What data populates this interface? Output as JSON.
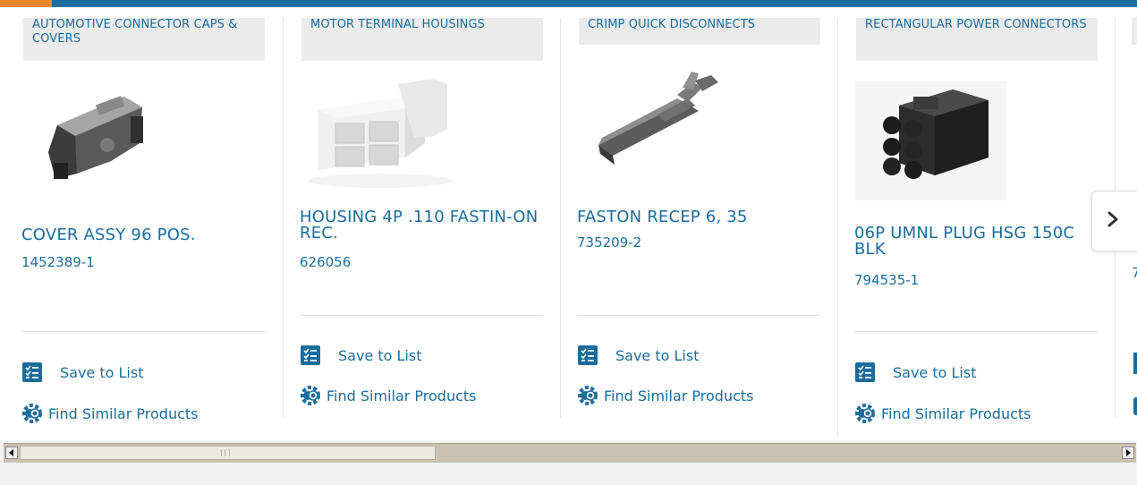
{
  "colors": {
    "brand_blue": "#1a6c9c",
    "accent_orange": "#e8862a",
    "tag_bg": "#ebebeb"
  },
  "carousel": {
    "cards": [
      {
        "category": "AUTOMOTIVE CONNECTOR CAPS & COVERS",
        "image_icon": "product-image-cover-assy",
        "title": "COVER ASSY 96 POS.",
        "part_number": "1452389-1",
        "save_label": "Save to List",
        "similar_label": "Find Similar Products"
      },
      {
        "category": "MOTOR TERMINAL HOUSINGS",
        "image_icon": "product-image-housing",
        "title": "HOUSING 4P .110 FASTIN-ON REC.",
        "part_number": "626056",
        "save_label": "Save to List",
        "similar_label": "Find Similar Products"
      },
      {
        "category": "CRIMP QUICK DISCONNECTS",
        "image_icon": "product-image-faston",
        "title": "FASTON RECEP 6, 35",
        "part_number": "735209-2",
        "save_label": "Save to List",
        "similar_label": "Find Similar Products"
      },
      {
        "category": "RECTANGULAR POWER CONNECTORS",
        "image_icon": "product-image-plug-housing",
        "title": "06P UMNL PLUG HSG 150C BLK",
        "part_number": "794535-1",
        "save_label": "Save to List",
        "similar_label": "Find Similar Products"
      },
      {
        "category": "",
        "title": "",
        "part_number": "7",
        "save_label": "",
        "similar_label": ""
      }
    ],
    "next_icon": "chevron-right-icon"
  },
  "scrollbar": {
    "left_arrow_icon": "arrow-left-icon",
    "right_arrow_icon": "arrow-right-icon"
  }
}
